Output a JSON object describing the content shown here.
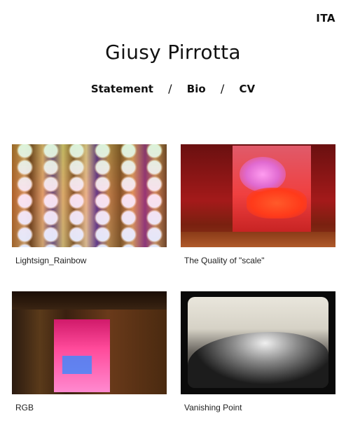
{
  "header": {
    "language_toggle": "ITA",
    "site_title": "Giusy Pirrotta"
  },
  "nav": {
    "items": [
      "Statement",
      "Bio",
      "CV"
    ],
    "separator": "/"
  },
  "works": [
    {
      "caption": "Lightsign_Rainbow"
    },
    {
      "caption": "The Quality of \"scale\""
    },
    {
      "caption": "RGB"
    },
    {
      "caption": "Vanishing Point"
    }
  ]
}
